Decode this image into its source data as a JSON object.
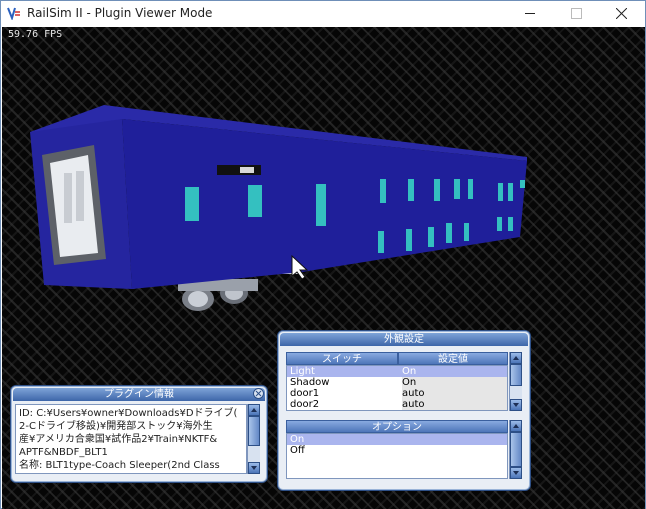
{
  "window": {
    "title": "RailSim II - Plugin Viewer Mode",
    "fps": "59.76 FPS"
  },
  "appearance_panel": {
    "title": "外観設定",
    "col_switch": "スイッチ",
    "col_value": "設定値",
    "switches": [
      {
        "name": "Light",
        "value": "On",
        "selected": true
      },
      {
        "name": "Shadow",
        "value": "On",
        "selected": false
      },
      {
        "name": "door1",
        "value": "auto",
        "selected": false
      },
      {
        "name": "door2",
        "value": "auto",
        "selected": false
      }
    ],
    "options_title": "オプション",
    "options": [
      {
        "label": "On",
        "selected": true
      },
      {
        "label": "Off",
        "selected": false
      }
    ]
  },
  "plugin_panel": {
    "title": "プラグイン情報",
    "lines": [
      "ID: C:¥Users¥owner¥Downloads¥Dドライブ(",
      "2-Cドライブ移設)¥開発部ストック¥海外生",
      "産¥アメリカ合衆国¥試作品2¥Train¥NKTF&",
      "APTF&NBDF_BLT1",
      "名称: BLT1type-Coach Sleeper(2nd Class"
    ]
  },
  "colors": {
    "coach_body": "#1f1f9a",
    "window_glass": "#34c0c0",
    "panel_header": "#3d66a9",
    "selection": "#aab5ee"
  }
}
